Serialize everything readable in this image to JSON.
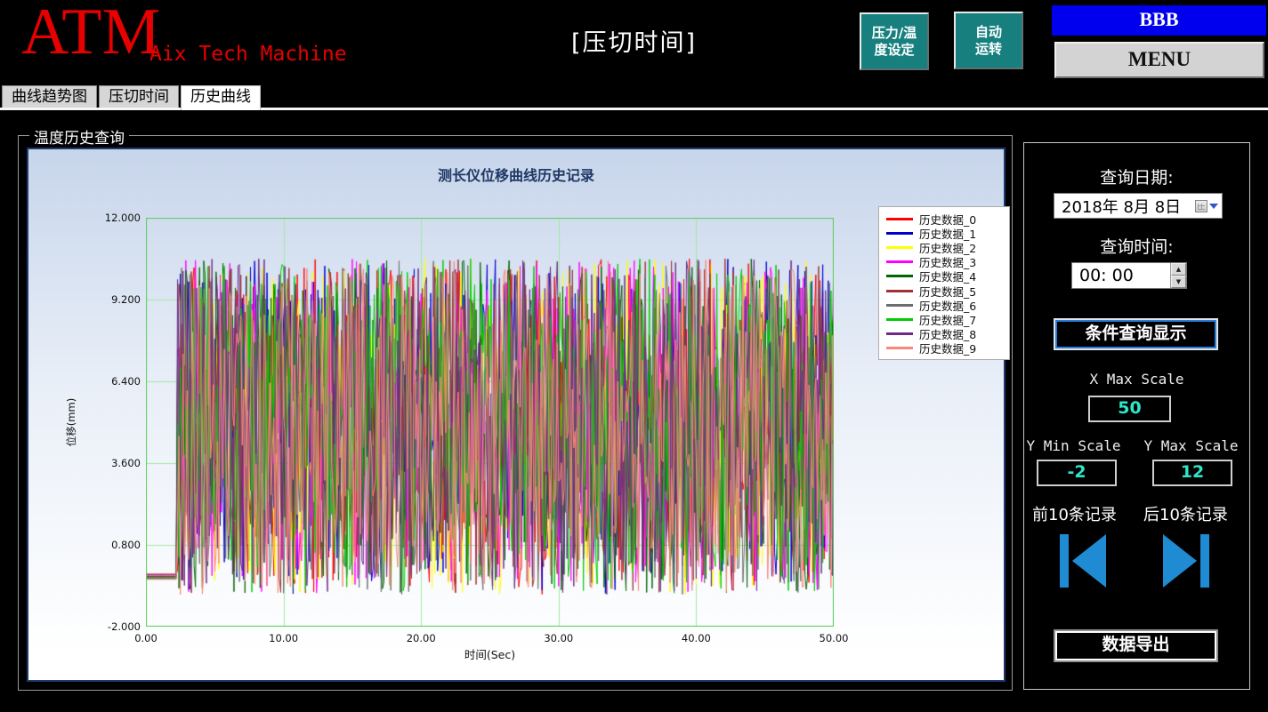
{
  "header": {
    "logo": "ATM",
    "logo_sub": "Aix Tech Machine",
    "page_title": "[压切时间]",
    "pressure_btn": [
      "压力/温",
      "度设定"
    ],
    "auto_btn": [
      "自动",
      "运转"
    ],
    "bbb": "BBB",
    "menu": "MENU",
    "teal_color": "#17807f",
    "bbb_color": "#0000ef"
  },
  "tabs": [
    {
      "label": "曲线趋势图",
      "active": false
    },
    {
      "label": "压切时间",
      "active": false
    },
    {
      "label": "历史曲线",
      "active": true
    }
  ],
  "group_box": {
    "title": "温度历史查询"
  },
  "chart_data": {
    "type": "line",
    "title": "测长仪位移曲线历史记录",
    "xlabel": "时间(Sec)",
    "ylabel": "位移(mm)",
    "xlim": [
      0,
      50
    ],
    "ylim": [
      -2,
      12
    ],
    "x_ticks": [
      "0.00",
      "10.00",
      "20.00",
      "30.00",
      "40.00",
      "50.00"
    ],
    "x_tick_values": [
      0,
      10,
      20,
      30,
      40,
      50
    ],
    "y_ticks": [
      "12.000",
      "9.200",
      "6.400",
      "3.600",
      "0.800",
      "-2.000"
    ],
    "y_tick_values": [
      12,
      9.2,
      6.4,
      3.6,
      0.8,
      -2
    ],
    "grid": true,
    "legend_position": "right-top",
    "series": [
      {
        "name": "历史数据_0",
        "color": "#ff0000"
      },
      {
        "name": "历史数据_1",
        "color": "#0000cc"
      },
      {
        "name": "历史数据_2",
        "color": "#ffff00"
      },
      {
        "name": "历史数据_3",
        "color": "#ff00ff"
      },
      {
        "name": "历史数据_4",
        "color": "#006400"
      },
      {
        "name": "历史数据_5",
        "color": "#9e3434"
      },
      {
        "name": "历史数据_6",
        "color": "#6e6e6e"
      },
      {
        "name": "历史数据_7",
        "color": "#00cc00"
      },
      {
        "name": "历史数据_8",
        "color": "#6b2d83"
      },
      {
        "name": "历史数据_9",
        "color": "#fa8878"
      }
    ],
    "generation": {
      "seed": 20180808,
      "points_per_series": 500,
      "flat_until_sec": 2.2,
      "flat_value": -0.2,
      "noise_min": -0.9,
      "noise_max": 10.6
    },
    "colors": {
      "plot_border": "#55cc55",
      "grid": "#a2e8a2",
      "title": "#1f3864"
    }
  },
  "sidebar": {
    "query_date_label": "查询日期:",
    "date_value": "2018年 8月 8日",
    "query_time_label": "查询时间:",
    "time_value": "00: 00",
    "query_button": "条件查询显示",
    "x_max_label": "X Max Scale",
    "x_max_value": "50",
    "y_min_label": "Y Min Scale",
    "y_min_value": "-2",
    "y_max_label": "Y Max Scale",
    "y_max_value": "12",
    "prev_label": "前10条记录",
    "next_label": "后10条记录",
    "export_button": "数据导出",
    "value_color": "#2ee6c8",
    "arrow_color": "#1e8bd2"
  }
}
